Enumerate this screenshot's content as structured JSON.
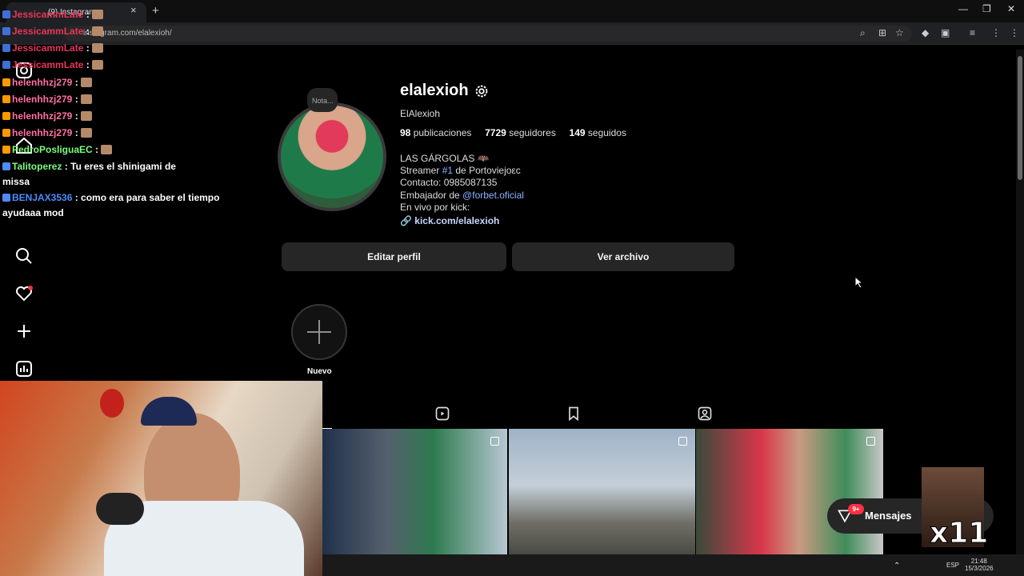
{
  "browser": {
    "tab_title": "(9) Instagram",
    "url": "instagram.com/elalexioh/",
    "new_tab": "+",
    "tab_close": "×",
    "window_controls": [
      "—",
      "❐",
      "✕"
    ]
  },
  "profile": {
    "note": "Nota...",
    "username": "elalexioh",
    "full_name": "ElAlexioh",
    "posts_count": "98",
    "posts_label": "publicaciones",
    "followers_count": "7729",
    "followers_label": "seguidores",
    "following_count": "149",
    "following_label": "seguidos",
    "bio_line1": "LAS GÁRGOLAS 🦇",
    "bio_line2_pre": "Streamer ",
    "bio_line2_tag": "#1",
    "bio_line2_post": " de Portoviejoεc",
    "bio_line3": "Contacto: 0985087135",
    "bio_line4_pre": "Embajador de ",
    "bio_line4_mention": "@forbet.oficial",
    "bio_line5": "En vivo por kick:",
    "link": "kick.com/elalexioh",
    "edit_button": "Editar perfil",
    "archive_button": "Ver archivo",
    "highlight_new": "Nuevo"
  },
  "chat": [
    {
      "user": "JessicammLate",
      "color": "#e8375a",
      "text": ""
    },
    {
      "user": "JessicammLate",
      "color": "#e8375a",
      "text": ""
    },
    {
      "user": "JessicammLate",
      "color": "#e8375a",
      "text": ""
    },
    {
      "user": "JessicammLate",
      "color": "#e8375a",
      "text": ""
    },
    {
      "user": "helenhhzj279",
      "color": "#ff6fa1",
      "text": ""
    },
    {
      "user": "helenhhzj279",
      "color": "#ff6fa1",
      "text": ""
    },
    {
      "user": "helenhhzj279",
      "color": "#ff6fa1",
      "text": ""
    },
    {
      "user": "helenhhzj279",
      "color": "#ff6fa1",
      "text": ""
    },
    {
      "user": "PedroPosliguaEC",
      "color": "#7cfc7c",
      "text": ""
    },
    {
      "user": "Talitoperez",
      "color": "#7cfc7c",
      "text": "Tu eres el shinigami de"
    },
    {
      "user": "",
      "color": "#fff",
      "text": "missa"
    },
    {
      "user": "BENJAX3536",
      "color": "#4f8bff",
      "text": "como era para saber el tiempo"
    },
    {
      "user": "",
      "color": "#fff",
      "text": "ayudaaa mod"
    }
  ],
  "colon": " : ",
  "messages": {
    "label": "Mensajes",
    "badge": "9+"
  },
  "emote_label": "x11",
  "taskbar": {
    "lang": "ESP",
    "time": "21:48",
    "date": "15/3/2026"
  },
  "colors": {
    "bg": "#000000",
    "button": "#262626",
    "link": "#8ab4ff",
    "notif": "#ff3040"
  },
  "icons": [
    "instagram-icon",
    "home-icon",
    "search-icon",
    "heart-icon",
    "plus-icon",
    "stats-icon",
    "reels-tab-icon",
    "saved-tab-icon",
    "tagged-tab-icon",
    "gear-icon",
    "link-icon"
  ]
}
